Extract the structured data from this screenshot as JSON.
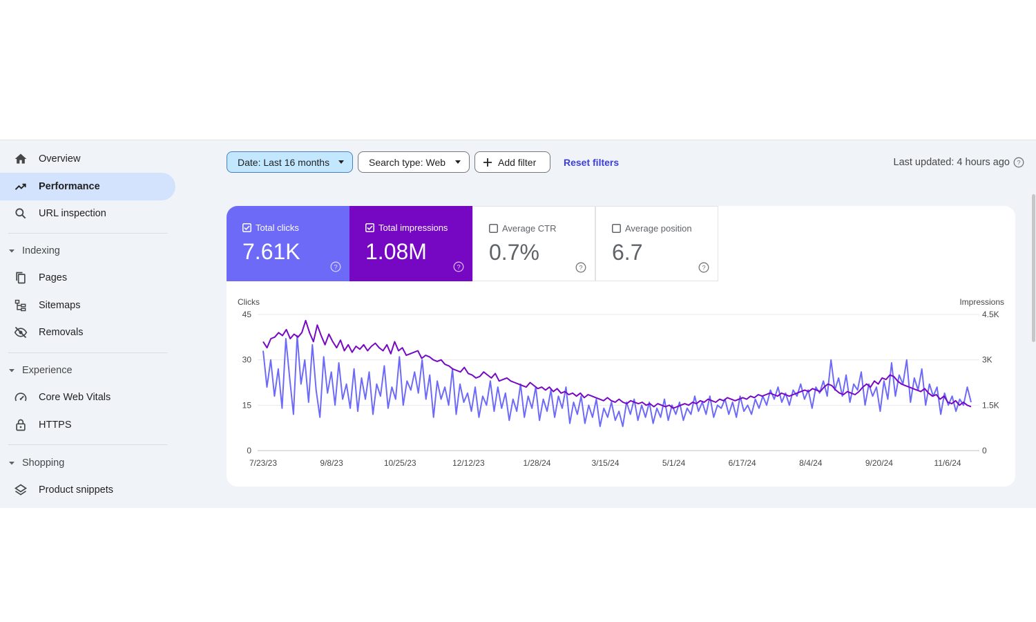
{
  "sidebar": {
    "overview": "Overview",
    "performance": "Performance",
    "url_inspection": "URL inspection",
    "indexing": {
      "title": "Indexing",
      "pages": "Pages",
      "sitemaps": "Sitemaps",
      "removals": "Removals"
    },
    "experience": {
      "title": "Experience",
      "cwv": "Core Web Vitals",
      "https": "HTTPS"
    },
    "shopping": {
      "title": "Shopping",
      "product_snippets": "Product snippets"
    }
  },
  "toolbar": {
    "date_filter": "Date: Last 16 months",
    "search_type": "Search type: Web",
    "add_filter": "Add filter",
    "reset_filters": "Reset filters",
    "last_updated": "Last updated: 4 hours ago"
  },
  "metrics": [
    {
      "label": "Total clicks",
      "value": "7.61K",
      "checked": true,
      "color": "#6d6af8"
    },
    {
      "label": "Total impressions",
      "value": "1.08M",
      "checked": true,
      "color": "#7608c4"
    },
    {
      "label": "Average CTR",
      "value": "0.7%",
      "checked": false
    },
    {
      "label": "Average position",
      "value": "6.7",
      "checked": false
    }
  ],
  "colors": {
    "clicks": "#6d6af8",
    "impressions": "#7608c4",
    "accent": "#3c3cd6",
    "active_nav": "#d3e3fd"
  },
  "chart_data": {
    "type": "line",
    "ylabel_left": "Clicks",
    "ylabel_right": "Impressions",
    "yticks_left": [
      "0",
      "15",
      "30",
      "45"
    ],
    "yticks_right": [
      "0",
      "1.5K",
      "3K",
      "4.5K"
    ],
    "ylim_left": [
      0,
      45
    ],
    "ylim_right": [
      0,
      4500
    ],
    "xticks": [
      "7/23/23",
      "9/8/23",
      "10/25/23",
      "12/12/23",
      "1/28/24",
      "3/15/24",
      "5/1/24",
      "6/17/24",
      "8/4/24",
      "9/20/24",
      "11/6/24"
    ],
    "x_start": "2023-07-23",
    "x_end": "2024-11-27",
    "grid": true,
    "series": [
      {
        "name": "Clicks",
        "axis": "left",
        "values": [
          33,
          21,
          30,
          18,
          27,
          14,
          37,
          24,
          12,
          38,
          22,
          30,
          16,
          35,
          20,
          11,
          31,
          19,
          26,
          15,
          29,
          17,
          22,
          14,
          27,
          13,
          24,
          17,
          26,
          12,
          22,
          18,
          28,
          14,
          21,
          17,
          31,
          15,
          23,
          20,
          26,
          19,
          30,
          17,
          25,
          11,
          23,
          17,
          21,
          15,
          27,
          12,
          22,
          16,
          19,
          13,
          21,
          11,
          18,
          15,
          23,
          13,
          21,
          14,
          19,
          10,
          17,
          13,
          22,
          11,
          18,
          14,
          21,
          10,
          17,
          13,
          20,
          11,
          18,
          14,
          21,
          9,
          16,
          12,
          18,
          9,
          15,
          11,
          17,
          8,
          14,
          11,
          16,
          10,
          13,
          8,
          16,
          12,
          17,
          10,
          15,
          11,
          16,
          9,
          14,
          11,
          17,
          10,
          15,
          12,
          16,
          10,
          14,
          12,
          18,
          13,
          16,
          12,
          18,
          11,
          15,
          14,
          17,
          12,
          16,
          11,
          18,
          13,
          15,
          12,
          17,
          14,
          18,
          15,
          20,
          17,
          21,
          16,
          19,
          15,
          20,
          18,
          22,
          17,
          20,
          14,
          21,
          19,
          23,
          18,
          30,
          20,
          24,
          18,
          25,
          16,
          22,
          20,
          26,
          15,
          22,
          18,
          21,
          13,
          23,
          17,
          29,
          18,
          25,
          22,
          30,
          16,
          24,
          20,
          27,
          15,
          22,
          18,
          21,
          12,
          19,
          15,
          18,
          13,
          17,
          15,
          21,
          16
        ]
      },
      {
        "name": "Impressions",
        "axis": "right",
        "values": [
          3600,
          3400,
          3700,
          3750,
          3900,
          3800,
          4000,
          3700,
          3850,
          3750,
          3900,
          4300,
          3900,
          3600,
          4150,
          3800,
          3500,
          3850,
          3600,
          3400,
          3650,
          3300,
          3500,
          3250,
          3450,
          3350,
          3500,
          3300,
          3450,
          3550,
          3400,
          3300,
          3500,
          3200,
          3600,
          3300,
          3400,
          3150,
          3200,
          3250,
          3300,
          3050,
          3150,
          3100,
          3000,
          2950,
          3000,
          2850,
          2800,
          2700,
          2650,
          2600,
          2750,
          2550,
          2500,
          2400,
          2450,
          2600,
          2500,
          2400,
          2550,
          2300,
          2350,
          2400,
          2300,
          2250,
          2200,
          2150,
          2100,
          2250,
          2150,
          2050,
          2100,
          2000,
          2100,
          1950,
          2050,
          1900,
          1950,
          1850,
          1900,
          1800,
          1900,
          1750,
          1850,
          1800,
          1750,
          1700,
          1650,
          1750,
          1650,
          1600,
          1700,
          1600,
          1550,
          1650,
          1600,
          1550,
          1600,
          1500,
          1550,
          1450,
          1550,
          1500,
          1450,
          1500,
          1400,
          1450,
          1500,
          1550,
          1500,
          1600,
          1550,
          1650,
          1600,
          1700,
          1650,
          1600,
          1700,
          1650,
          1750,
          1700,
          1650,
          1700,
          1750,
          1700,
          1800,
          1750,
          1850,
          1800,
          1850,
          1900,
          1850,
          1800,
          1900,
          1850,
          1800,
          1850,
          1900,
          1950,
          2000,
          1950,
          2050,
          2000,
          1950,
          2100,
          2200,
          2150,
          2000,
          1900,
          1850,
          1950,
          1900,
          1850,
          1950,
          2100,
          2200,
          2100,
          2300,
          2200,
          2400,
          2350,
          2500,
          2450,
          2300,
          2200,
          2150,
          2100,
          2050,
          2000,
          1950,
          2050,
          1900,
          1800,
          1850,
          1700,
          1800,
          1600,
          1550,
          1650,
          1500,
          1600,
          1500,
          1450
        ]
      }
    ]
  }
}
